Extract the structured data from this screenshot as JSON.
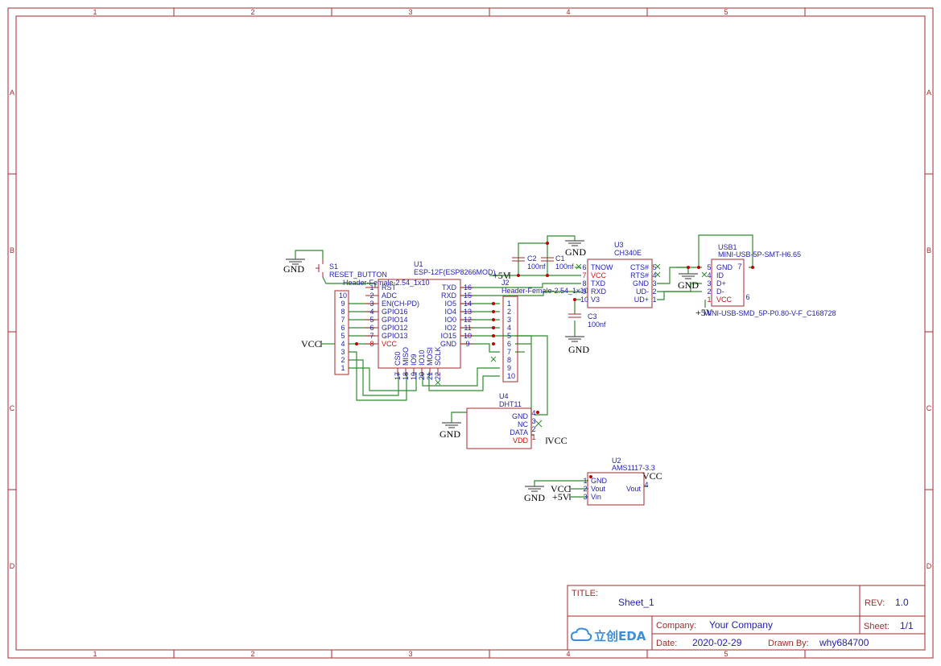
{
  "zones": {
    "columns": [
      "1",
      "2",
      "3",
      "4",
      "5"
    ],
    "rows": [
      "A",
      "B",
      "C",
      "D"
    ]
  },
  "title_block": {
    "title_label": "TITLE:",
    "title_value": "Sheet_1",
    "rev_label": "REV:",
    "rev_value": "1.0",
    "company_label": "Company:",
    "company_value": "Your Company",
    "sheet_label": "Sheet:",
    "sheet_value": "1/1",
    "date_label": "Date:",
    "date_value": "2020-02-29",
    "drawn_label": "Drawn By:",
    "drawn_value": "why684700",
    "logo_text": "立创EDA"
  },
  "nets": {
    "gnd": "GND",
    "vcc": "VCC",
    "p5v": "+5V"
  },
  "components": {
    "s1": {
      "ref": "S1",
      "name": "RESET_BUTTON"
    },
    "j1": {
      "ref": "",
      "name": "Header-Female-2.54_1x10",
      "pins": [
        "10",
        "9",
        "8",
        "7",
        "6",
        "5",
        "4",
        "3",
        "2",
        "1"
      ]
    },
    "u1": {
      "ref": "U1",
      "name": "ESP-12F(ESP8266MOD)",
      "left_pins": [
        {
          "num": "1",
          "name": "RST"
        },
        {
          "num": "2",
          "name": "ADC"
        },
        {
          "num": "3",
          "name": "EN(CH-PD)"
        },
        {
          "num": "4",
          "name": "GPIO16"
        },
        {
          "num": "5",
          "name": "GPIO14"
        },
        {
          "num": "6",
          "name": "GPIO12"
        },
        {
          "num": "7",
          "name": "GPIO13"
        },
        {
          "num": "8",
          "name": "VCC"
        }
      ],
      "right_pins": [
        {
          "num": "16",
          "name": "TXD"
        },
        {
          "num": "15",
          "name": "RXD"
        },
        {
          "num": "14",
          "name": "IO5"
        },
        {
          "num": "13",
          "name": "IO4"
        },
        {
          "num": "12",
          "name": "IO0"
        },
        {
          "num": "11",
          "name": "IO2"
        },
        {
          "num": "10",
          "name": "IO15"
        },
        {
          "num": "9",
          "name": "GND"
        }
      ],
      "bottom_pins": [
        {
          "num": "17",
          "name": "CS0"
        },
        {
          "num": "18",
          "name": "MISO"
        },
        {
          "num": "19",
          "name": "IO9"
        },
        {
          "num": "20",
          "name": "IO10"
        },
        {
          "num": "21",
          "name": "MOSI"
        },
        {
          "num": "22",
          "name": "SCLK"
        }
      ]
    },
    "j2": {
      "ref": "J2",
      "name": "Header-Female-2.54_1x10",
      "pins": [
        "1",
        "2",
        "3",
        "4",
        "5",
        "6",
        "7",
        "8",
        "9",
        "10"
      ]
    },
    "c1": {
      "ref": "C1",
      "value": "100nf"
    },
    "c2": {
      "ref": "C2",
      "value": "100nf"
    },
    "c3": {
      "ref": "C3",
      "value": "100nf"
    },
    "u3": {
      "ref": "U3",
      "name": "CH340E",
      "left_pins": [
        {
          "num": "6",
          "name": "TNOW"
        },
        {
          "num": "7",
          "name": "VCC"
        },
        {
          "num": "8",
          "name": "TXD"
        },
        {
          "num": "9",
          "name": "RXD"
        },
        {
          "num": "10",
          "name": "V3"
        }
      ],
      "right_pins": [
        {
          "num": "5",
          "name": "CTS#"
        },
        {
          "num": "4",
          "name": "RTS#"
        },
        {
          "num": "3",
          "name": "GND"
        },
        {
          "num": "2",
          "name": "UD-"
        },
        {
          "num": "1",
          "name": "UD+"
        }
      ]
    },
    "usb1": {
      "ref": "USB1",
      "name": "MINI-USB-5P-SMT-H6.65",
      "footprint": "MINI-USB-SMD_5P-P0.80-V-F_C168728",
      "pins": [
        {
          "num": "5",
          "name": "GND"
        },
        {
          "num": "4",
          "name": "ID"
        },
        {
          "num": "3",
          "name": "D+"
        },
        {
          "num": "2",
          "name": "D-"
        },
        {
          "num": "1",
          "name": "VCC"
        }
      ],
      "extra_pins": [
        "7",
        "6"
      ]
    },
    "u4": {
      "ref": "U4",
      "name": "DHT11",
      "pins": [
        {
          "num": "4",
          "name": "GND"
        },
        {
          "num": "3",
          "name": "NC"
        },
        {
          "num": "2",
          "name": "DATA"
        },
        {
          "num": "1",
          "name": "VDD"
        }
      ]
    },
    "u2": {
      "ref": "U2",
      "name": "AMS1117-3.3",
      "pins": [
        {
          "num": "1",
          "name": "GND"
        },
        {
          "num": "2",
          "name": "Vout"
        },
        {
          "num": "3",
          "name": "Vin"
        },
        {
          "num": "4",
          "name": "Vout"
        }
      ]
    }
  }
}
